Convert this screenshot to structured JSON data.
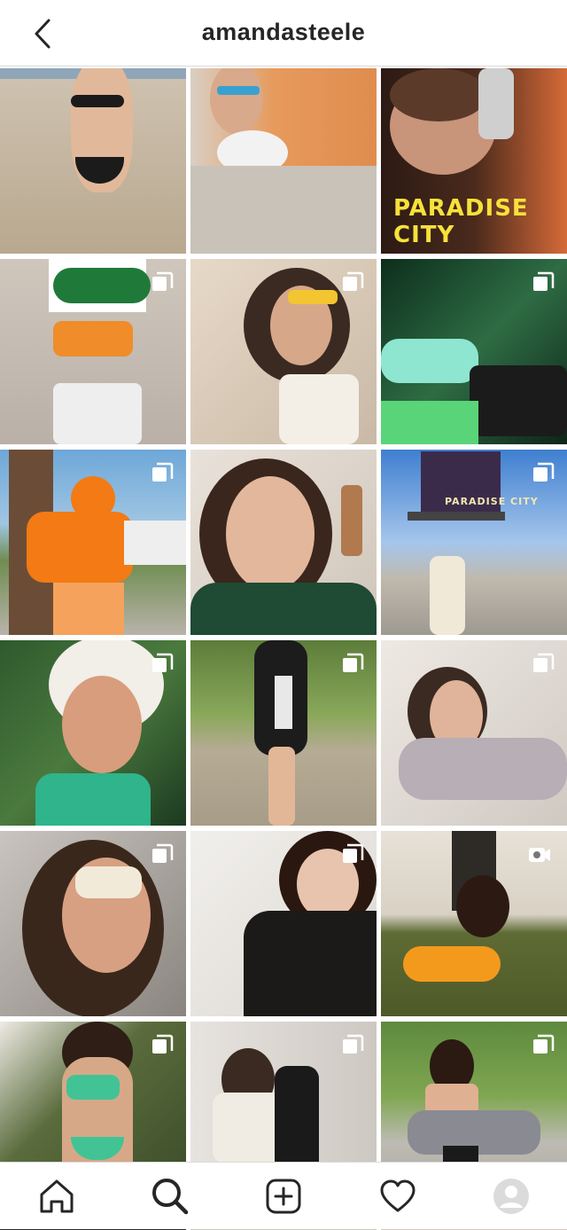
{
  "header": {
    "username": "amandasteele",
    "back_icon": "chevron-left-icon"
  },
  "grid": {
    "tiles": [
      {
        "id": "post-1",
        "badge": "none",
        "overlay_text": ""
      },
      {
        "id": "post-2",
        "badge": "none",
        "overlay_text": ""
      },
      {
        "id": "post-3",
        "badge": "none",
        "overlay_text": "PARADISE CITY"
      },
      {
        "id": "post-4",
        "badge": "carousel"
      },
      {
        "id": "post-5",
        "badge": "carousel"
      },
      {
        "id": "post-6",
        "badge": "carousel"
      },
      {
        "id": "post-7",
        "badge": "carousel"
      },
      {
        "id": "post-8",
        "badge": "none"
      },
      {
        "id": "post-9",
        "badge": "carousel",
        "billboard_text": "PARADISE CITY"
      },
      {
        "id": "post-10",
        "badge": "carousel"
      },
      {
        "id": "post-11",
        "badge": "carousel"
      },
      {
        "id": "post-12",
        "badge": "carousel"
      },
      {
        "id": "post-13",
        "badge": "carousel"
      },
      {
        "id": "post-14",
        "badge": "carousel"
      },
      {
        "id": "post-15",
        "badge": "video"
      },
      {
        "id": "post-16",
        "badge": "carousel"
      },
      {
        "id": "post-17",
        "badge": "carousel"
      },
      {
        "id": "post-18",
        "badge": "carousel"
      }
    ]
  },
  "bottom_nav": {
    "items": [
      {
        "name": "home",
        "icon": "home-icon"
      },
      {
        "name": "search",
        "icon": "search-icon",
        "active": true
      },
      {
        "name": "new-post",
        "icon": "plus-square-icon"
      },
      {
        "name": "activity",
        "icon": "heart-icon"
      },
      {
        "name": "profile",
        "icon": "avatar-icon"
      }
    ]
  },
  "colors": {
    "text": "#262626",
    "divider": "#dbdbdb",
    "background": "#ffffff",
    "overlay_yellow": "#f7e23a"
  }
}
